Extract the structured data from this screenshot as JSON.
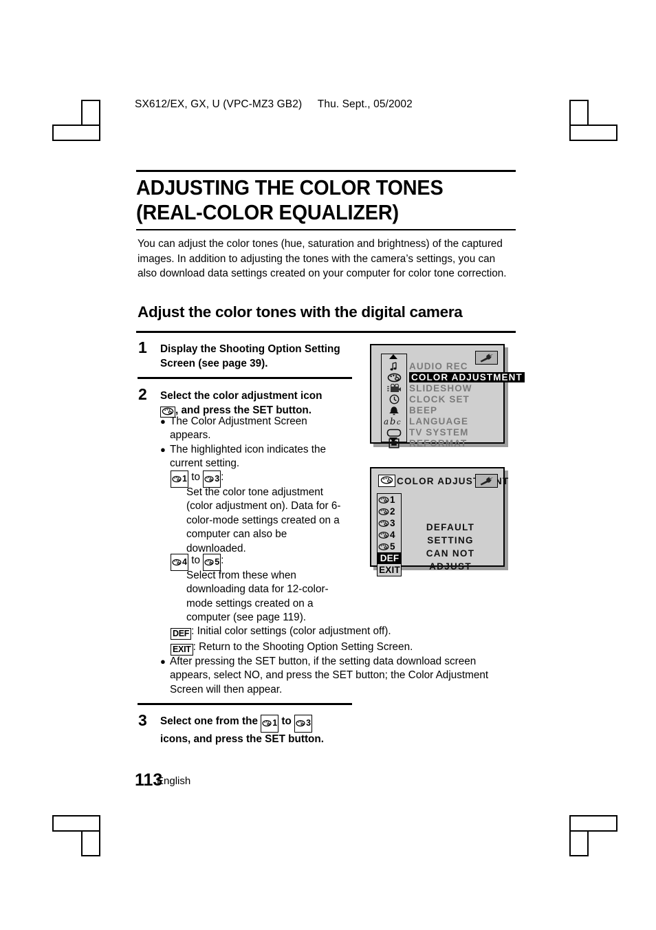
{
  "header": {
    "model": "SX612/EX, GX, U (VPC-MZ3 GB2)",
    "date": "Thu. Sept., 05/2002"
  },
  "title": {
    "line1": "ADJUSTING THE COLOR TONES",
    "line2": "(REAL-COLOR EQUALIZER)"
  },
  "intro": "You can adjust the color tones (hue, saturation and brightness) of the captured images. In addition to adjusting the tones with the camera’s settings, you can also download data settings created on your computer for color tone correction.",
  "subheading": "Adjust the color tones with the digital camera",
  "steps": [
    {
      "number": "1",
      "title_line1": "Display the Shooting Option Setting",
      "title_line2": "Screen (see page 39)."
    },
    {
      "number": "2",
      "title_line1": "Select the color adjustment icon",
      "title_line2_pre": ", and press the SET button.",
      "bullet1": "The Color Adjustment Screen appears.",
      "bullet2": "The highlighted icon indicates the current setting.",
      "range_a_from": "1",
      "range_a_to": "3",
      "range_a_sep": "to",
      "range_a_colon": ":",
      "range_a_desc": "Set the color tone adjustment (color adjustment on). Data for 6-color-mode settings created on a computer can also be downloaded.",
      "range_b_from": "4",
      "range_b_to": "5",
      "range_b_sep": "to",
      "range_b_colon": ":",
      "range_b_desc": "Select from these when downloading data for 12-color-mode settings created on a computer (see page 119).",
      "def_key": "DEF",
      "def_desc": ":  Initial color settings (color adjustment off).",
      "exit_key": "EXIT",
      "exit_desc": ":  Return to the Shooting Option Setting Screen.",
      "bullet3": "After pressing the SET button, if the setting data download screen appears, select NO, and press the SET button; the Color Adjustment Screen will then appear."
    },
    {
      "number": "3",
      "title_pre": "Select one from the",
      "range_from": "1",
      "range_sep": "to",
      "range_to": "3",
      "title_post": "icons, and press the SET button."
    }
  ],
  "lcd_menu": {
    "wrench_icon": "wrench-icon",
    "scroll_up_icon": "triangle-up-icon",
    "scroll_down_icon": "triangle-down-icon",
    "items": [
      {
        "icon": "music-note-icon",
        "label": "AUDIO REC",
        "selected": false
      },
      {
        "icon": "palette-icon",
        "label": "COLOR ADJUSTMENT",
        "selected": true
      },
      {
        "icon": "movie-camera-icon",
        "label": "SLIDESHOW",
        "selected": false
      },
      {
        "icon": "clock-icon",
        "label": "CLOCK SET",
        "selected": false
      },
      {
        "icon": "bell-icon",
        "label": "BEEP",
        "selected": false
      },
      {
        "icon": "abc-icon",
        "label": "LANGUAGE",
        "selected": false
      },
      {
        "icon": "tv-icon",
        "label": "TV SYSTEM",
        "selected": false
      },
      {
        "icon": "reformat-icon",
        "label": "REFORMAT",
        "selected": false
      }
    ]
  },
  "lcd_color": {
    "title": "COLOR ADJUSTMENT",
    "title_icon": "palette-icon",
    "wrench_icon": "wrench-icon",
    "message_line1": "DEFAULT SETTING",
    "message_line2": "CAN NOT ADJUST",
    "side_items": [
      {
        "type": "palette",
        "label": "1",
        "selected": false
      },
      {
        "type": "palette",
        "label": "2",
        "selected": false
      },
      {
        "type": "palette",
        "label": "3",
        "selected": false
      },
      {
        "type": "palette",
        "label": "4",
        "selected": false
      },
      {
        "type": "palette",
        "label": "5",
        "selected": false
      },
      {
        "type": "text",
        "label": "DEF",
        "selected": true
      },
      {
        "type": "text",
        "label": "EXIT",
        "selected": false
      }
    ]
  },
  "footer": {
    "page_number": "113",
    "language": "English"
  },
  "colors": {
    "lcd_background": "#cfcfcf",
    "lcd_dim_text": "#7a7a7a",
    "lcd_shadow": "#9d9d9d",
    "wrench_box": "#b4b4b4"
  }
}
